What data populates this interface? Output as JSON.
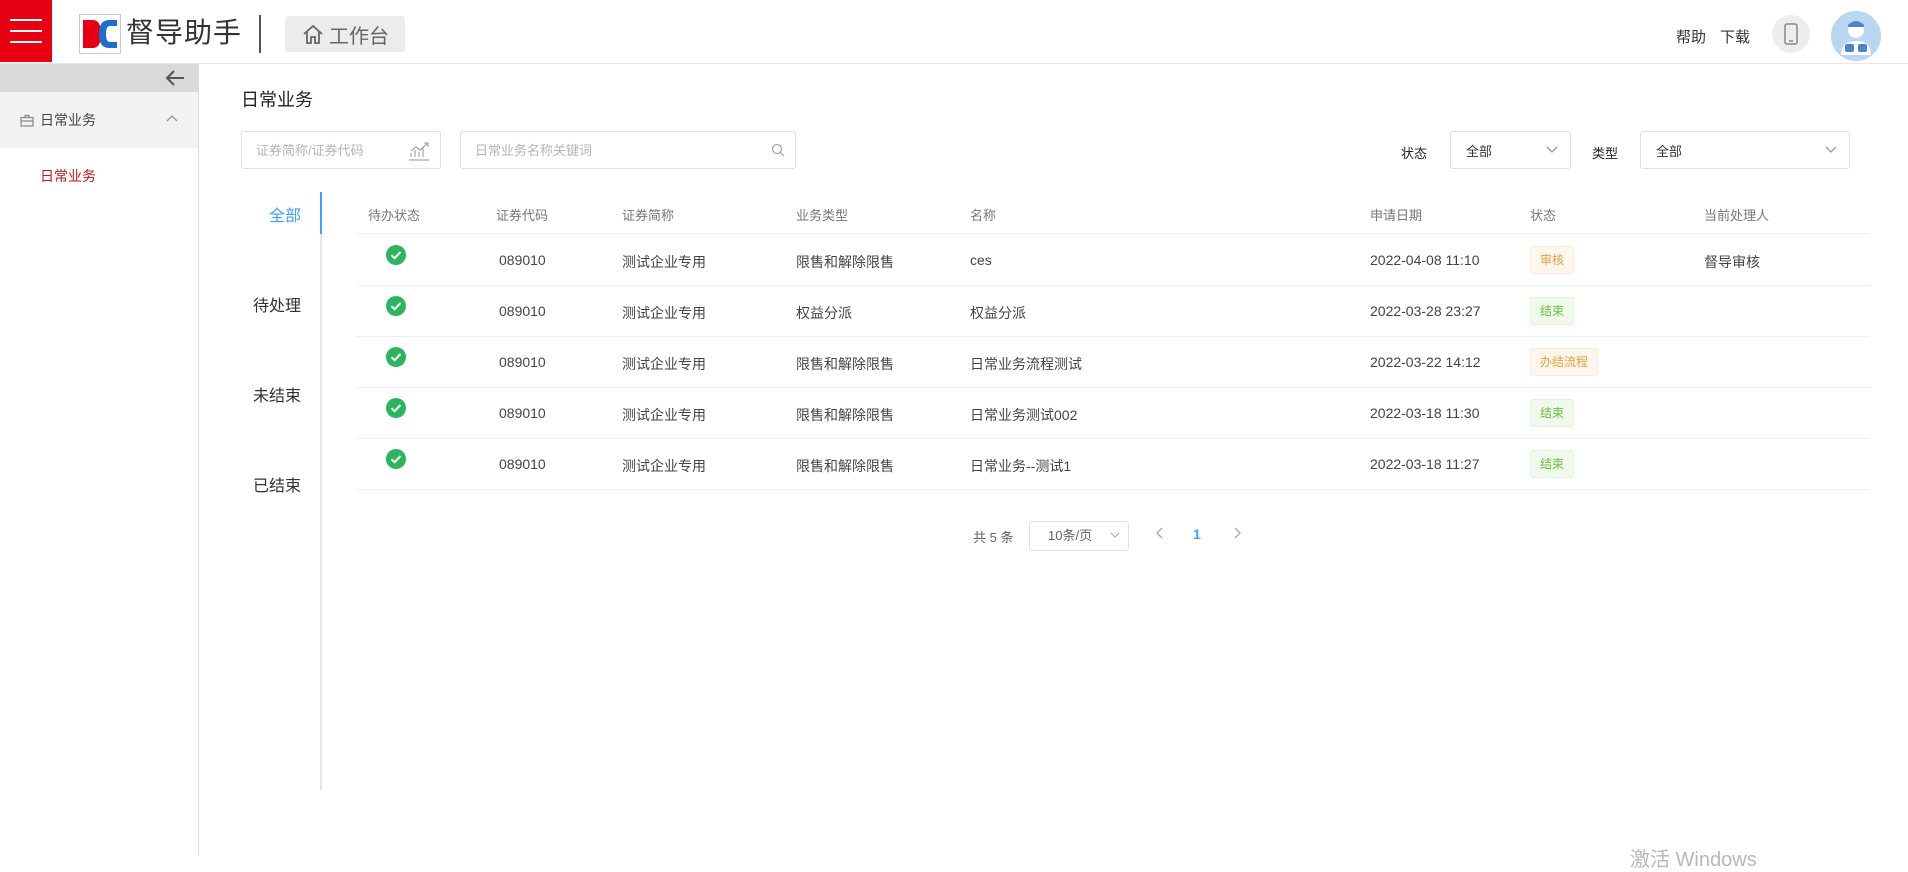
{
  "header": {
    "app_name": "督导助手",
    "workbench_label": "工作台",
    "help_label": "帮助",
    "download_label": "下载",
    "brand_color": "#e60012",
    "logo_color_red": "#e60012",
    "logo_color_blue": "#1b6fd1"
  },
  "sidebar": {
    "group_label": "日常业务",
    "items": [
      {
        "label": "日常业务",
        "active": true
      }
    ]
  },
  "page": {
    "title": "日常业务",
    "search_security_placeholder": "证券简称/证券代码",
    "search_name_placeholder": "日常业务名称关键词",
    "status_label": "状态",
    "status_value": "全部",
    "type_label": "类型",
    "type_value": "全部"
  },
  "tabs": [
    {
      "label": "全部",
      "active": true
    },
    {
      "label": "待处理",
      "active": false
    },
    {
      "label": "未结束",
      "active": false
    },
    {
      "label": "已结束",
      "active": false
    }
  ],
  "table": {
    "columns": [
      "待办状态",
      "证券代码",
      "证券简称",
      "业务类型",
      "名称",
      "申请日期",
      "状态",
      "当前处理人"
    ],
    "rows": [
      {
        "code": "089010",
        "short_name": "测试企业专用",
        "biz_type": "限售和解除限售",
        "name": "ces",
        "date": "2022-04-08 11:10",
        "status": "审核",
        "status_kind": "warn",
        "handler": "督导审核"
      },
      {
        "code": "089010",
        "short_name": "测试企业专用",
        "biz_type": "权益分派",
        "name": "权益分派",
        "date": "2022-03-28 23:27",
        "status": "结束",
        "status_kind": "success",
        "handler": ""
      },
      {
        "code": "089010",
        "short_name": "测试企业专用",
        "biz_type": "限售和解除限售",
        "name": "日常业务流程测试",
        "date": "2022-03-22 14:12",
        "status": "办结流程",
        "status_kind": "warn",
        "handler": ""
      },
      {
        "code": "089010",
        "short_name": "测试企业专用",
        "biz_type": "限售和解除限售",
        "name": "日常业务测试002",
        "date": "2022-03-18 11:30",
        "status": "结束",
        "status_kind": "success",
        "handler": ""
      },
      {
        "code": "089010",
        "short_name": "测试企业专用",
        "biz_type": "限售和解除限售",
        "name": "日常业务--测试1",
        "date": "2022-03-18 11:27",
        "status": "结束",
        "status_kind": "success",
        "handler": ""
      }
    ]
  },
  "pagination": {
    "total_text": "共 5 条",
    "page_size": "10条/页",
    "current_page": "1"
  },
  "watermark": "激活 Windows",
  "icons": {
    "done": "check-circle-icon",
    "search": "search-icon",
    "chart": "chart-icon",
    "home": "home-icon"
  }
}
